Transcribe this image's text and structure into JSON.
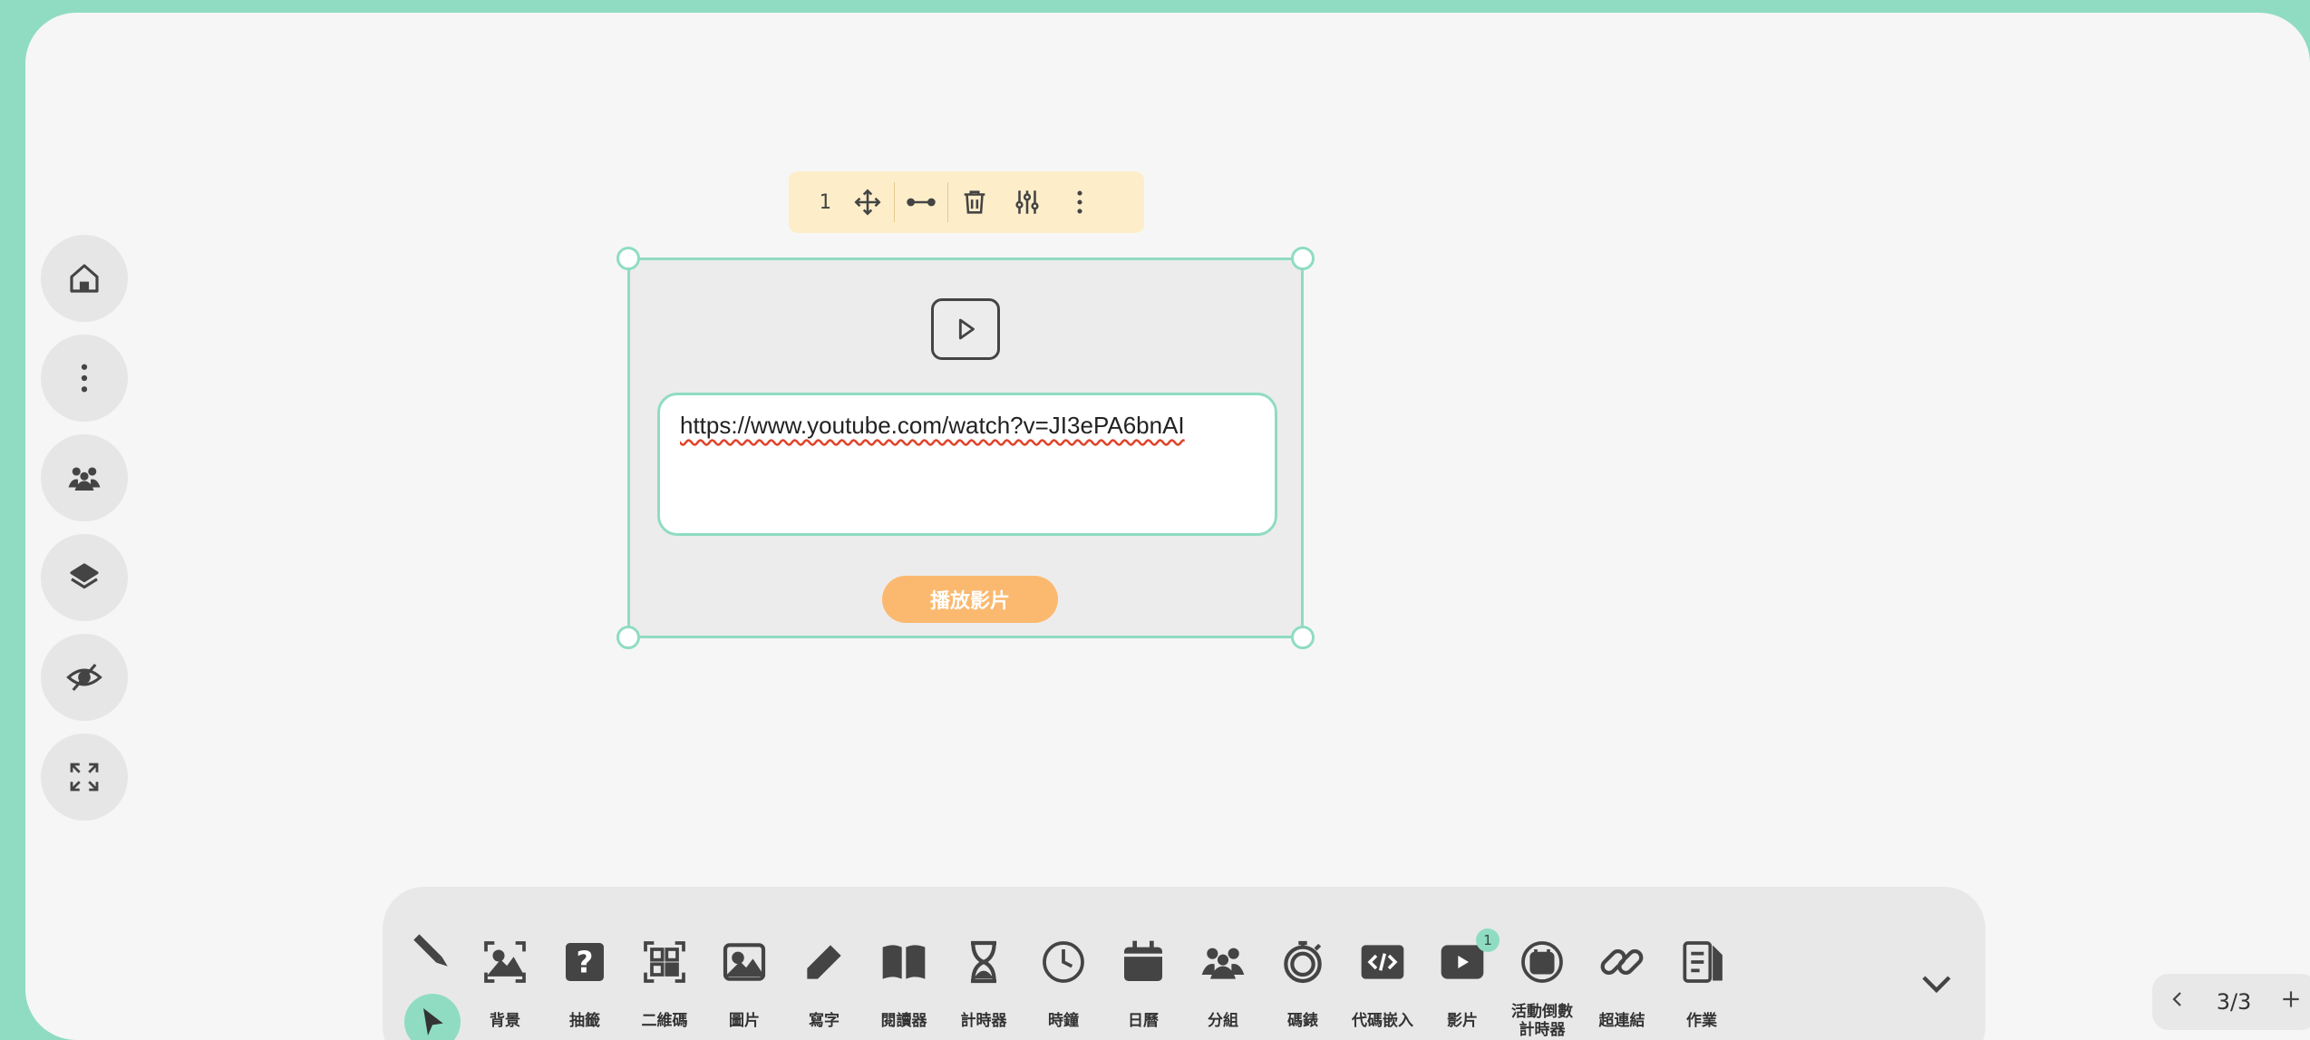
{
  "left_rail": {
    "items": [
      {
        "name": "home",
        "icon": "home-icon"
      },
      {
        "name": "more",
        "icon": "more-vertical-icon"
      },
      {
        "name": "groups",
        "icon": "people-icon"
      },
      {
        "name": "layers",
        "icon": "layers-icon"
      },
      {
        "name": "hide",
        "icon": "eye-off-icon"
      },
      {
        "name": "fullscreen",
        "icon": "fullscreen-icon"
      }
    ]
  },
  "element_toolbar": {
    "layer_order": "1",
    "icons": [
      "move-icon",
      "width-icon",
      "delete-icon",
      "settings-sliders-icon",
      "more-vertical-icon"
    ]
  },
  "video_widget": {
    "icon": "play-icon",
    "url_value": "https://www.youtube.com/watch?v=JI3ePA6bnAI",
    "play_label": "播放影片"
  },
  "dock": {
    "tools": [
      {
        "label": "背景",
        "icon": "background-image-icon"
      },
      {
        "label": "抽籤",
        "icon": "question-card-icon"
      },
      {
        "label": "二維碼",
        "icon": "qr-code-icon"
      },
      {
        "label": "圖片",
        "icon": "image-icon"
      },
      {
        "label": "寫字",
        "icon": "pencil-icon"
      },
      {
        "label": "閱讀器",
        "icon": "book-icon"
      },
      {
        "label": "計時器",
        "icon": "hourglass-icon"
      },
      {
        "label": "時鐘",
        "icon": "clock-icon"
      },
      {
        "label": "日曆",
        "icon": "calendar-icon"
      },
      {
        "label": "分組",
        "icon": "group-icon"
      },
      {
        "label": "碼錶",
        "icon": "stopwatch-icon"
      },
      {
        "label": "代碼嵌入",
        "icon": "code-embed-icon"
      },
      {
        "label": "影片",
        "icon": "video-icon",
        "badge": "1"
      },
      {
        "label": "活動倒數計時器",
        "icon": "countdown-icon"
      },
      {
        "label": "超連結",
        "icon": "link-icon"
      },
      {
        "label": "作業",
        "icon": "homework-icon"
      }
    ]
  },
  "page_nav": {
    "page_indicator": "3/3",
    "prev_icon": "chevron-left-icon",
    "add_icon": "plus-icon"
  },
  "colors": {
    "accent": "#8fdcc2",
    "play_button": "#fbb970",
    "toolbar_bg": "#fdeec9"
  }
}
